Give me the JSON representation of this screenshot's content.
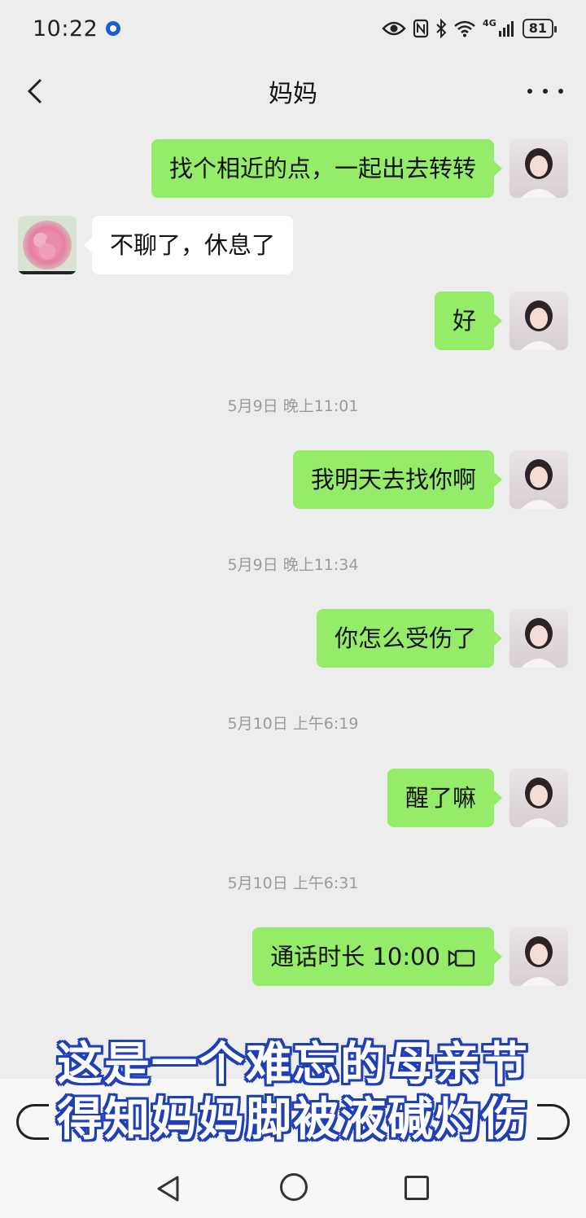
{
  "status_bar": {
    "time": "10:22",
    "network": "4G",
    "battery": "81"
  },
  "header": {
    "title": "妈妈"
  },
  "messages": [
    {
      "side": "self",
      "text": "找个相近的点，一起出去转转"
    },
    {
      "side": "other",
      "text": "不聊了，休息了"
    },
    {
      "side": "self",
      "text": "好"
    },
    {
      "timestamp": "5月9日 晚上11:01"
    },
    {
      "side": "self",
      "text": "我明天去找你啊"
    },
    {
      "timestamp": "5月9日 晚上11:34"
    },
    {
      "side": "self",
      "text": "你怎么受伤了"
    },
    {
      "timestamp": "5月10日 上午6:19"
    },
    {
      "side": "self",
      "text": "醒了嘛"
    },
    {
      "timestamp": "5月10日 上午6:31"
    },
    {
      "side": "self",
      "text": "通话时长 10:00",
      "icon": "video-call-icon"
    }
  ],
  "caption": {
    "line1": "这是一个难忘的母亲节",
    "line2": "得知妈妈脚被液碱灼伤"
  },
  "colors": {
    "self_bubble": "#95ec69",
    "other_bubble": "#ffffff",
    "background": "#ededed",
    "caption_outline": "#1f3fb6"
  }
}
